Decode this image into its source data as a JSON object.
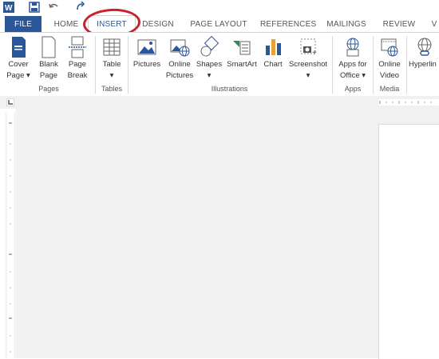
{
  "tabs": {
    "file": "FILE",
    "home": "HOME",
    "insert": "INSERT",
    "design": "DESIGN",
    "page_layout": "PAGE LAYOUT",
    "references": "REFERENCES",
    "mailings": "MAILINGS",
    "review": "REVIEW",
    "view": "V"
  },
  "ribbon": {
    "pages": {
      "cover_1": "Cover",
      "cover_2": "Page ▾",
      "blank_1": "Blank",
      "blank_2": "Page",
      "break_1": "Page",
      "break_2": "Break",
      "group": "Pages"
    },
    "tables": {
      "table": "Table",
      "caret": "▾",
      "group": "Tables"
    },
    "illustrations": {
      "pictures": "Pictures",
      "online_1": "Online",
      "online_2": "Pictures",
      "shapes": "Shapes",
      "shapes_caret": "▾",
      "smartart": "SmartArt",
      "chart": "Chart",
      "screenshot": "Screenshot",
      "screenshot_caret": "▾",
      "group": "Illustrations"
    },
    "apps": {
      "apps_1": "Apps for",
      "apps_2": "Office ▾",
      "group": "Apps"
    },
    "media": {
      "video_1": "Online",
      "video_2": "Video",
      "group": "Media"
    },
    "links": {
      "hyperlink": "Hyperlin"
    }
  },
  "colors": {
    "file_tab": "#2b579a",
    "highlight_circle": "#c8202c",
    "icon_blue": "#2b579a",
    "icon_green": "#2e8b57"
  }
}
